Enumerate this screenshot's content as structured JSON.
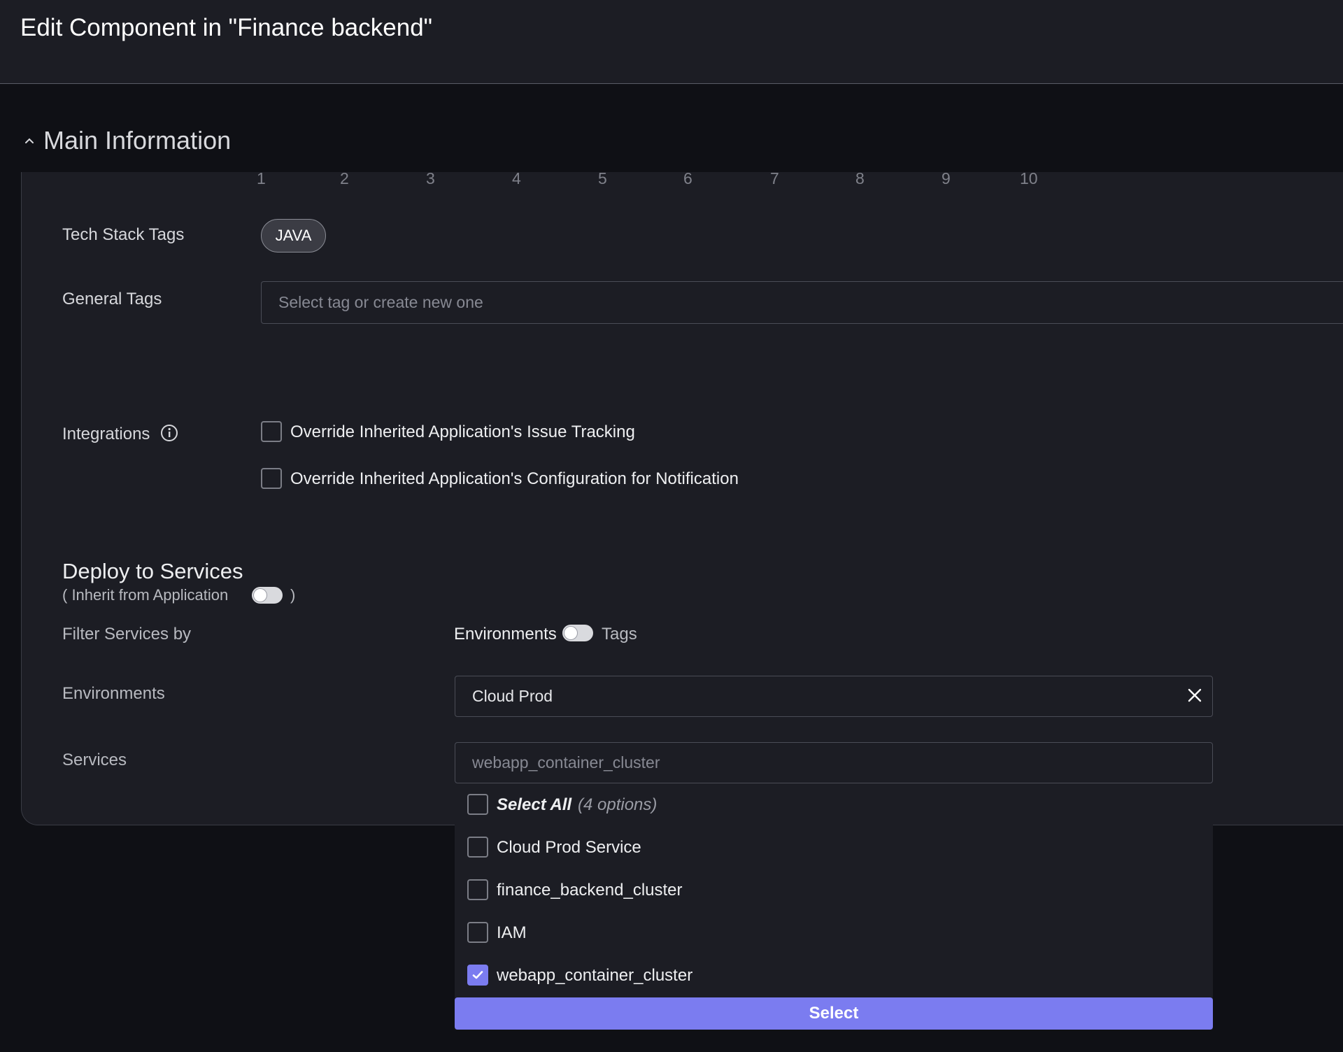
{
  "header": {
    "title": "Edit Component in  \"Finance backend\""
  },
  "section": {
    "title": "Main Information"
  },
  "scale": [
    "1",
    "2",
    "3",
    "4",
    "5",
    "6",
    "7",
    "8",
    "9",
    "10"
  ],
  "tech_stack": {
    "label": "Tech Stack Tags",
    "tags": [
      "JAVA"
    ]
  },
  "general_tags": {
    "label": "General Tags",
    "placeholder": "Select tag or create new one"
  },
  "integrations": {
    "label": "Integrations",
    "options": [
      {
        "label": "Override Inherited Application's Issue Tracking",
        "checked": false
      },
      {
        "label": "Override Inherited Application's Configuration for Notification",
        "checked": false
      }
    ]
  },
  "deploy": {
    "title": "Deploy to Services",
    "inherit_prefix": "( Inherit from Application",
    "inherit_suffix": ")",
    "inherit_on": false,
    "filter_label": "Filter Services by",
    "filter_left": "Environments",
    "filter_right": "Tags",
    "environments_label": "Environments",
    "environments_value": "Cloud Prod",
    "services_label": "Services",
    "services_placeholder": "webapp_container_cluster"
  },
  "services_dropdown": {
    "select_all": "Select All",
    "select_all_count": "(4 options)",
    "options": [
      {
        "label": "Cloud Prod Service",
        "checked": false
      },
      {
        "label": "finance_backend_cluster",
        "checked": false
      },
      {
        "label": "IAM",
        "checked": false
      },
      {
        "label": "webapp_container_cluster",
        "checked": true
      }
    ],
    "button": "Select"
  },
  "colors": {
    "accent": "#7b7cf0",
    "panel": "#1c1d24",
    "background": "#0f1015"
  }
}
